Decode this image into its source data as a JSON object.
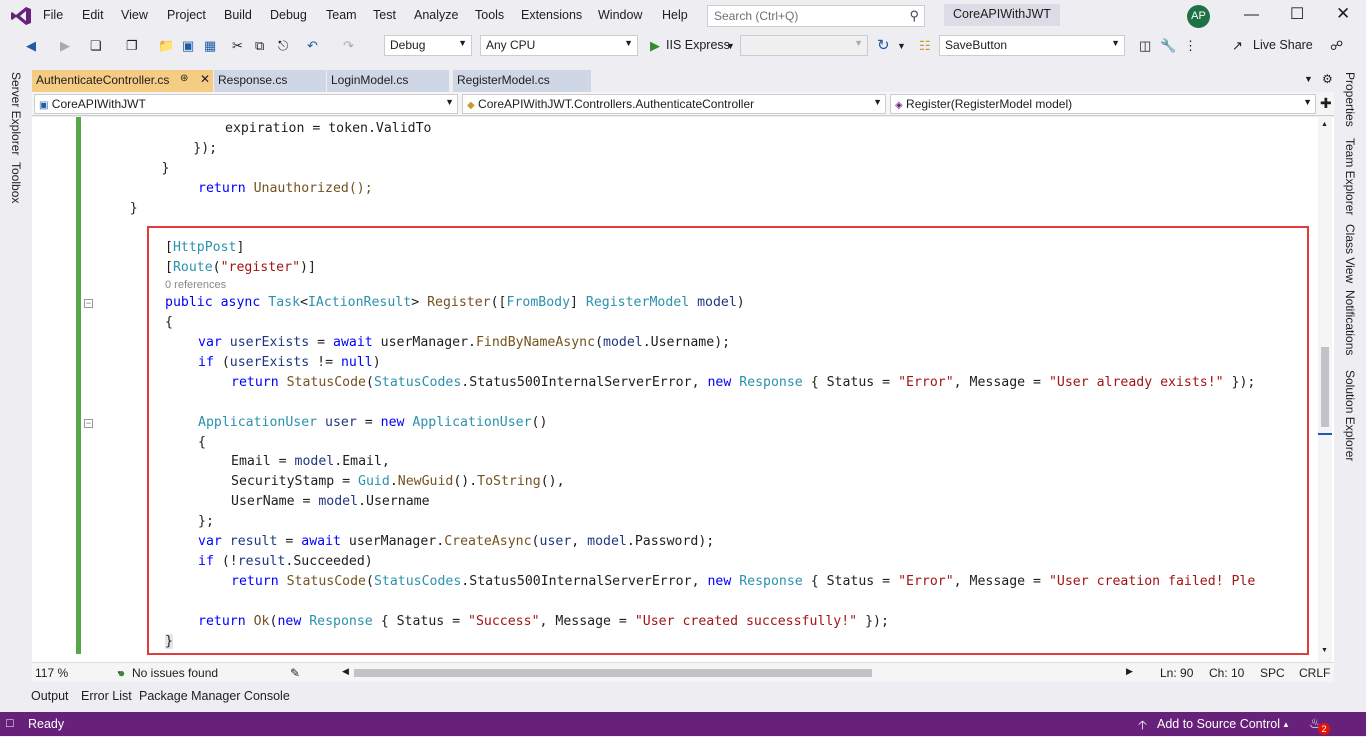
{
  "menu": [
    "File",
    "Edit",
    "View",
    "Project",
    "Build",
    "Debug",
    "Team",
    "Test",
    "Analyze",
    "Tools",
    "Extensions",
    "Window",
    "Help"
  ],
  "search": {
    "placeholder": "Search (Ctrl+Q)"
  },
  "solution_name": "CoreAPIWithJWT",
  "avatar_initials": "AP",
  "toolbar": {
    "configuration": "Debug",
    "platform": "Any CPU",
    "run_target": "IIS Express",
    "find_combo": "SaveButton",
    "live_share": "Live Share"
  },
  "left_tools": [
    "Server Explorer",
    "Toolbox"
  ],
  "right_tools": [
    "Properties",
    "Team Explorer",
    "Class View",
    "Notifications",
    "Solution Explorer"
  ],
  "tabs": [
    {
      "label": "AuthenticateController.cs",
      "active": true
    },
    {
      "label": "Response.cs",
      "active": false
    },
    {
      "label": "LoginModel.cs",
      "active": false
    },
    {
      "label": "RegisterModel.cs",
      "active": false
    }
  ],
  "nav": {
    "project": "CoreAPIWithJWT",
    "class": "CoreAPIWithJWT.Controllers.AuthenticateController",
    "member": "Register(RegisterModel model)"
  },
  "code": {
    "l1": "                expiration = token.ValidTo",
    "l2": "            });",
    "l3": "        }",
    "l4_return": "return",
    "l4_rest": " Unauthorized();",
    "l5": "    }",
    "httppost": "HttpPost",
    "route": "Route",
    "route_arg": "\"register\"",
    "references": "0 references",
    "sig_public": "public",
    "sig_async": "async",
    "sig_task": "Task",
    "sig_iaction": "IActionResult",
    "sig_register": "Register",
    "sig_frombody": "FromBody",
    "sig_registermodel": "RegisterModel",
    "sig_model": "model",
    "open_brace": "{",
    "var": "var",
    "userExists": "userExists",
    "await": "await",
    "userManager": "userManager",
    "FindByNameAsync": "FindByNameAsync",
    "model": "model",
    "Username": "Username",
    "if": "if",
    "null": "null",
    "return": "return",
    "StatusCode": "StatusCode",
    "StatusCodes": "StatusCodes",
    "Status500": "Status500InternalServerError",
    "new": "new",
    "Response": "Response",
    "Status": "Status",
    "Error": "\"Error\"",
    "Message": "Message",
    "user_exists_msg": "\"User already exists!\"",
    "ApplicationUser": "ApplicationUser",
    "user": "user",
    "Email": "Email",
    "SecurityStamp": "SecurityStamp",
    "Guid": "Guid",
    "NewGuid": "NewGuid",
    "ToString": "ToString",
    "UserName": "UserName",
    "close_semi": "};",
    "result": "result",
    "CreateAsync": "CreateAsync",
    "Password": "Password",
    "Succeeded": "Succeeded",
    "create_failed_msg": "\"User creation failed! Ple",
    "Ok": "Ok",
    "Success": "\"Success\"",
    "created_msg": "\"User created successfully!\"",
    "close_brace": "}"
  },
  "editor_status": {
    "zoom": "117 %",
    "issues": "No issues found",
    "ln": "Ln: 90",
    "ch": "Ch: 10",
    "spc": "SPC",
    "crlf": "CRLF"
  },
  "bottom_tabs": [
    "Output",
    "Error List",
    "Package Manager Console"
  ],
  "statusbar": {
    "ready": "Ready",
    "source_control": "Add to Source Control",
    "notifications_count": "2"
  },
  "colors": {
    "accent": "#68217a",
    "active_tab": "#f5cc84",
    "highlight_box": "#e03c3c",
    "change_bar": "#57a64a"
  }
}
